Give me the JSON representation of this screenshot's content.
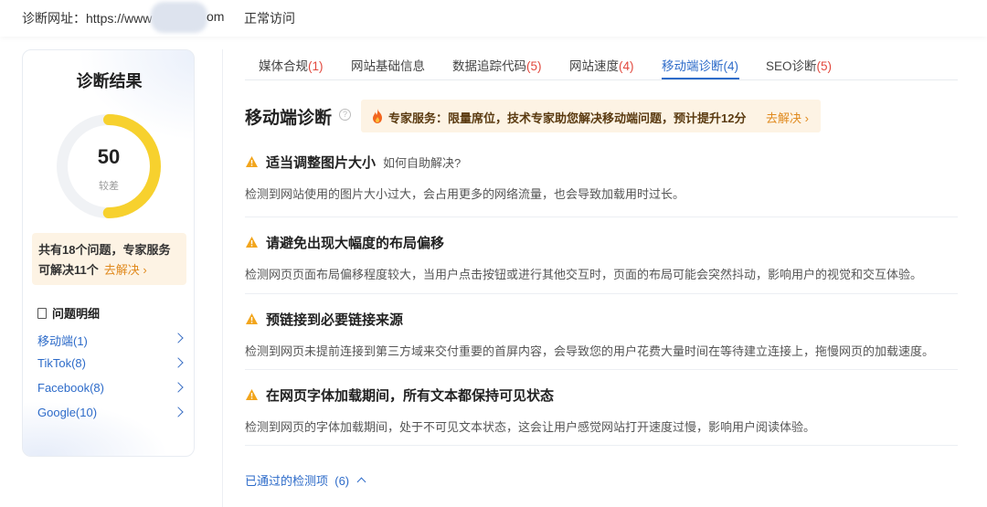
{
  "topbar": {
    "url_label": "诊断网址：https://www",
    "url_tail": "om",
    "status": "正常访问"
  },
  "summary": {
    "title": "诊断结果",
    "score": "50",
    "score_fraction": 0.5,
    "grade": "较差",
    "promo_line1": "共有18个问题，专家服务",
    "promo_line2": "可解决11个",
    "promo_link": "去解决 ›",
    "detail_title": "问题明细",
    "items": [
      {
        "label": "移动端(1)"
      },
      {
        "label": "TikTok(8)"
      },
      {
        "label": "Facebook(8)"
      },
      {
        "label": "Google(10)"
      }
    ],
    "colors": {
      "gauge": "#f7d12e",
      "track": "#f0f2f5",
      "promo_bg": "#fdf3e4"
    }
  },
  "tabs": [
    {
      "name": "媒体合规",
      "count": "(1)"
    },
    {
      "name": "网站基础信息",
      "count": ""
    },
    {
      "name": "数据追踪代码",
      "count": "(5)"
    },
    {
      "name": "网站速度",
      "count": "(4)"
    },
    {
      "name": "移动端诊断",
      "count": "(4)",
      "active": true
    },
    {
      "name": "SEO诊断",
      "count": "(5)"
    }
  ],
  "section": {
    "title": "移动端诊断",
    "help": "?",
    "expert_text": "专家服务：限量席位，技术专家助您解决移动端问题，预计提升12分",
    "expert_link": "去解决 ›"
  },
  "issues": [
    {
      "title": "适当调整图片大小",
      "sub": "如何自助解决?",
      "desc": "检测到网站使用的图片大小过大，会占用更多的网络流量，也会导致加载用时过长。"
    },
    {
      "title": "请避免出现大幅度的布局偏移",
      "sub": "",
      "desc": "检测网页页面布局偏移程度较大，当用户点击按钮或进行其他交互时，页面的布局可能会突然抖动，影响用户的视觉和交互体验。"
    },
    {
      "title": "预链接到必要链接来源",
      "sub": "",
      "desc": "检测到网页未提前连接到第三方域来交付重要的首屏内容，会导致您的用户花费大量时间在等待建立连接上，拖慢网页的加载速度。"
    },
    {
      "title": "在网页字体加载期间，所有文本都保持可见状态",
      "sub": "",
      "desc": "检测到网页的字体加载期间，处于不可见文本状态，这会让用户感觉网站打开速度过慢，影响用户阅读体验。"
    }
  ],
  "passed": {
    "label": "已通过的检测项",
    "count": "(6)"
  }
}
